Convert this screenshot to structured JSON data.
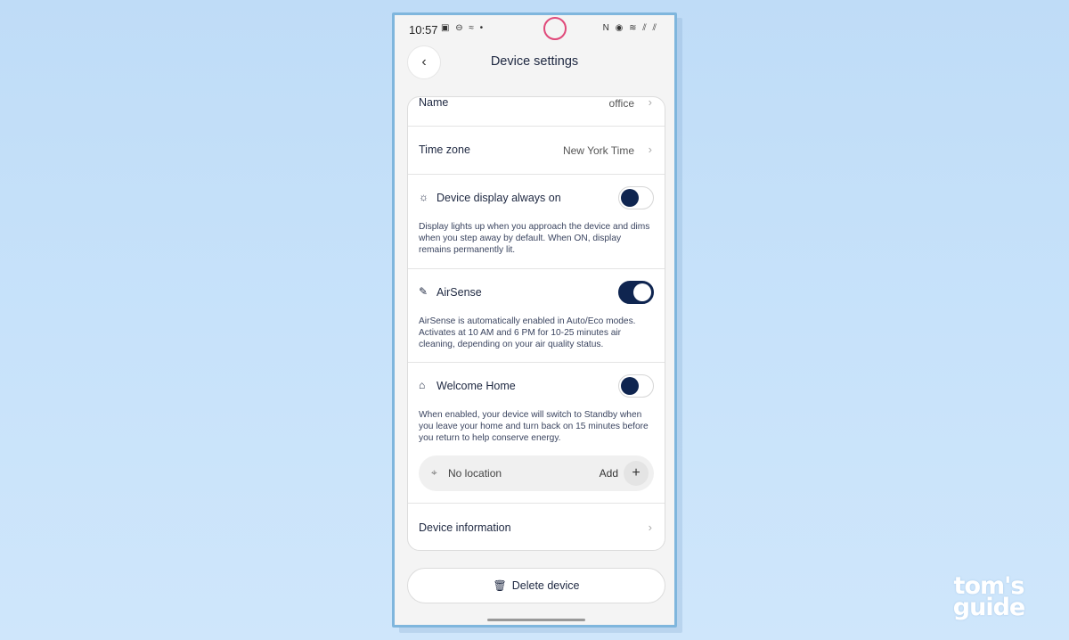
{
  "status_bar": {
    "time": "10:57",
    "left_icons": "▣ ⊖ ≈ •",
    "right_icons": "N ◉ ≋ ⫽ ⫽"
  },
  "header": {
    "back_icon": "‹",
    "title": "Device settings"
  },
  "settings": {
    "name": {
      "label": "Name",
      "value": "office",
      "chevron": "›"
    },
    "time_zone": {
      "label": "Time zone",
      "value": "New York Time",
      "chevron": "›"
    },
    "display": {
      "icon": "☼",
      "label": "Device display always on",
      "enabled": false,
      "description": "Display lights up when you approach the device and dims when you step away by default. When ON, display remains permanently lit."
    },
    "airsense": {
      "icon": "✎",
      "label": "AirSense",
      "enabled": true,
      "description": "AirSense is automatically enabled in Auto/Eco modes. Activates at 10 AM and 6 PM for 10-25 minutes air cleaning, depending on your air quality status."
    },
    "welcome_home": {
      "icon": "⌂",
      "label": "Welcome Home",
      "enabled": false,
      "description": "When enabled, your device will switch to Standby when you leave your home and turn back on 15 minutes before you return to help conserve energy.",
      "location": {
        "icon": "⌖",
        "text": "No location",
        "add_label": "Add",
        "plus": "+"
      }
    },
    "device_information": {
      "label": "Device information",
      "chevron": "›"
    }
  },
  "delete": {
    "icon": "🗑",
    "label": "Delete device"
  },
  "brand": {
    "line1": "tom's",
    "line2": "guide"
  },
  "colors": {
    "accent": "#0f2550",
    "camera_ring": "#e0497a",
    "background": "#c7e2fa"
  }
}
